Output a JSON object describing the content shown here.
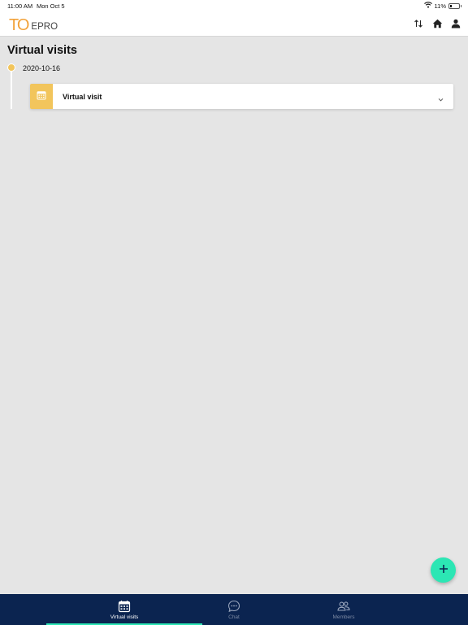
{
  "status_bar": {
    "time": "11:00 AM",
    "date": "Mon Oct 5",
    "battery": "11%"
  },
  "header": {
    "logo_mark": "TO",
    "logo_name": "EPRO",
    "icons": [
      "sort-arrows-icon",
      "home-icon",
      "user-icon"
    ]
  },
  "page": {
    "title": "Virtual visits"
  },
  "timeline": {
    "date": "2020-10-16",
    "entries": [
      {
        "label": "Virtual visit",
        "icon": "calendar-icon"
      }
    ]
  },
  "fab": {
    "icon": "plus-icon"
  },
  "bottom_nav": {
    "items": [
      {
        "label": "Virtual visits",
        "icon": "calendar-icon",
        "active": true
      },
      {
        "label": "Chat",
        "icon": "chat-bubble-icon",
        "active": false
      },
      {
        "label": "Members",
        "icon": "members-icon",
        "active": false
      }
    ]
  },
  "colors": {
    "accent": "#2ce6b4",
    "timeline": "#f2c55c",
    "logo": "#f2a23a",
    "nav_bg": "#0b2450",
    "page_bg": "#e5e5e5"
  }
}
